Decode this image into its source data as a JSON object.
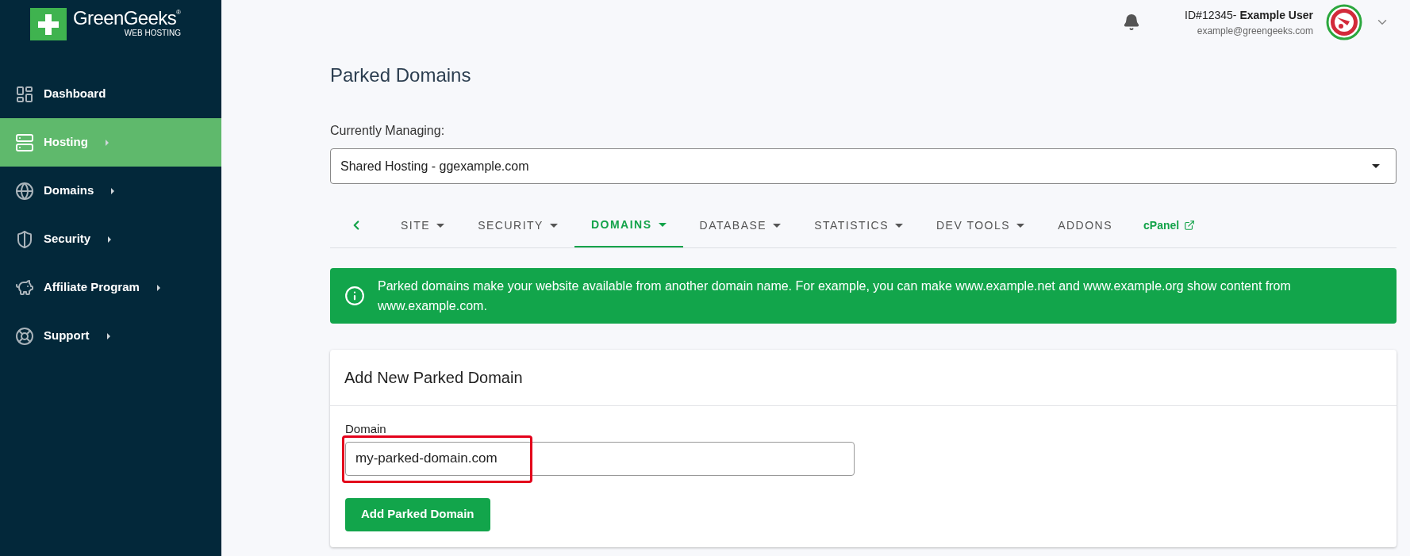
{
  "logo": {
    "name": "GreenGeeks",
    "registered": "®",
    "tagline": "WEB HOSTING"
  },
  "sidebar": {
    "items": [
      {
        "label": "Dashboard",
        "selected": false,
        "has_submenu": false
      },
      {
        "label": "Hosting",
        "selected": true,
        "has_submenu": true
      },
      {
        "label": "Domains",
        "selected": false,
        "has_submenu": true
      },
      {
        "label": "Security",
        "selected": false,
        "has_submenu": true
      },
      {
        "label": "Affiliate Program",
        "selected": false,
        "has_submenu": true
      },
      {
        "label": "Support",
        "selected": false,
        "has_submenu": true
      }
    ]
  },
  "header": {
    "user_id": "ID#12345-",
    "user_name": "Example User",
    "email": "example@greengeeks.com"
  },
  "page": {
    "title": "Parked Domains",
    "managing_label": "Currently Managing:",
    "managing_value": "Shared Hosting - ggexample.com"
  },
  "tabs": [
    {
      "kind": "back",
      "selected": false
    },
    {
      "kind": "tab",
      "label": "SITE",
      "selected": false,
      "dropdown": true
    },
    {
      "kind": "tab",
      "label": "SECURITY",
      "selected": false,
      "dropdown": true
    },
    {
      "kind": "tab",
      "label": "DOMAINS",
      "selected": true,
      "dropdown": true
    },
    {
      "kind": "tab",
      "label": "DATABASE",
      "selected": false,
      "dropdown": true
    },
    {
      "kind": "tab",
      "label": "STATISTICS",
      "selected": false,
      "dropdown": true
    },
    {
      "kind": "tab",
      "label": "DEV TOOLS",
      "selected": false,
      "dropdown": true
    },
    {
      "kind": "tab",
      "label": "ADDONS",
      "selected": false,
      "dropdown": false
    },
    {
      "kind": "external",
      "label": "cPanel",
      "selected": false
    }
  ],
  "alert": {
    "text": "Parked domains make your website available from another domain name. For example, you can make www.example.net and www.example.org show content from www.example.com."
  },
  "card": {
    "title": "Add New Parked Domain",
    "field_label": "Domain",
    "field_value": "my-parked-domain.com",
    "highlighted": true,
    "button": "Add Parked Domain"
  }
}
